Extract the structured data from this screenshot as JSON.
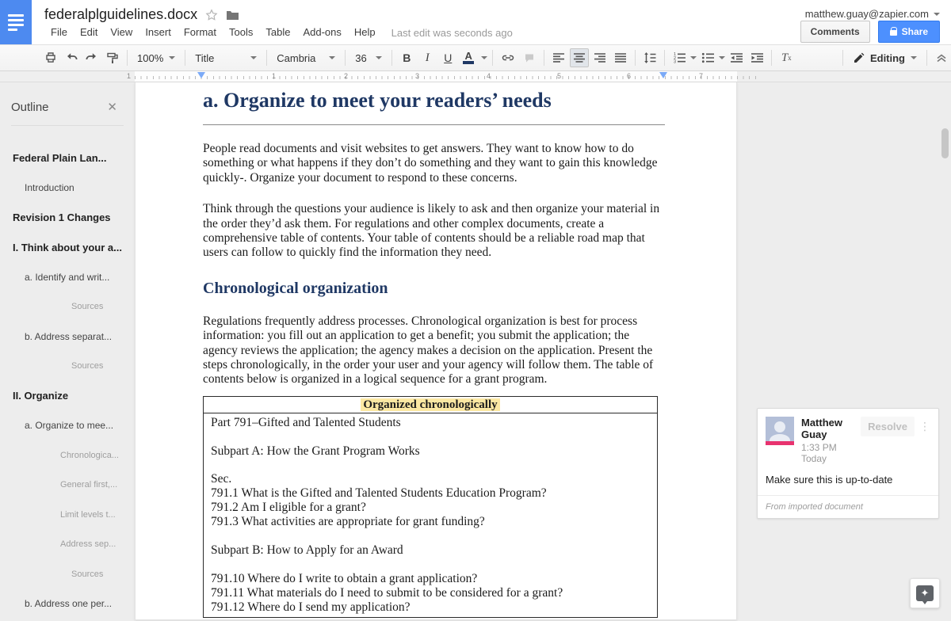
{
  "header": {
    "title": "federalplguidelines.docx",
    "menus": [
      "File",
      "Edit",
      "View",
      "Insert",
      "Format",
      "Tools",
      "Table",
      "Add-ons",
      "Help"
    ],
    "last_edit": "Last edit was seconds ago",
    "account_email": "matthew.guay@zapier.com",
    "comments_button": "Comments",
    "share_button": "Share"
  },
  "toolbar": {
    "zoom_value": "100%",
    "style_value": "Title",
    "font_value": "Cambria",
    "font_size_value": "36",
    "bold_label": "B",
    "italic_label": "I",
    "underline_label": "U",
    "text_color_label": "A",
    "text_color_swatch": "#1f3864",
    "clear_formatting_t": "T",
    "clear_formatting_x": "x",
    "mode_label": "Editing",
    "collapse_glyph": "^"
  },
  "ruler": {
    "numbers": [
      "1",
      "1",
      "2",
      "3",
      "4",
      "5",
      "6",
      "7"
    ]
  },
  "outline": {
    "title": "Outline",
    "close_glyph": "✕",
    "items": [
      {
        "label": "Federal Plain Lan...",
        "class": "lvl1"
      },
      {
        "label": "Introduction",
        "class": "lvl2"
      },
      {
        "label": "Revision 1 Changes",
        "class": "lvl1"
      },
      {
        "label": "I. Think about your a...",
        "class": "lvl1"
      },
      {
        "label": "a. Identify and writ...",
        "class": "lvl2"
      },
      {
        "label": "Sources",
        "class": "lvl4"
      },
      {
        "label": "b. Address separat...",
        "class": "lvl2"
      },
      {
        "label": "Sources",
        "class": "lvl4"
      },
      {
        "label": "II. Organize",
        "class": "lvl1"
      },
      {
        "label": "a. Organize to mee...",
        "class": "lvl2"
      },
      {
        "label": "Chronologica...",
        "class": "lvl3"
      },
      {
        "label": "General first,...",
        "class": "lvl3"
      },
      {
        "label": "Limit levels t...",
        "class": "lvl3"
      },
      {
        "label": "Address sep...",
        "class": "lvl3"
      },
      {
        "label": "Sources",
        "class": "lvl4"
      },
      {
        "label": "b. Address one per...",
        "class": "lvl2"
      }
    ]
  },
  "document": {
    "heading1": "a. Organize to meet your readers’ needs",
    "para1": "People read documents and visit websites to get answers. They want to know how to do something or what happens if they don’t do something and they want to gain this knowledge quickly-. Organize your document to respond to these concerns.",
    "para2": "Think through the questions your audience is likely to ask and then organize your material in the order they’d ask them. For regulations and other complex documents, create a comprehensive table of contents. Your table of contents should be a reliable road map that users can follow to quickly find the information they need.",
    "heading2": "Chronological organization",
    "para3": "Regulations frequently address processes. Chronological organization is best for process information: you fill out an application to get a benefit; you submit the application; the agency reviews the application; the agency makes a decision on the application. Present the steps chronologically, in the order your user and your agency will follow them. The table of contents below is organized in a logical sequence for a grant program.",
    "table": {
      "header": "Organized chronologically",
      "highlight_color": "#fce8a3",
      "lines": [
        "Part 791–Gifted and Talented Students",
        "",
        "Subpart A: How the Grant Program Works",
        "",
        "Sec.",
        "791.1 What is the Gifted and Talented Students Education Program?",
        "791.2 Am I eligible for a grant?",
        "791.3 What activities are appropriate for grant funding?",
        "",
        "Subpart B: How to Apply for an Award",
        "",
        "791.10 Where do I write to obtain a grant application?",
        "791.11 What materials do I need to submit to be considered for a grant?",
        "791.12 Where do I send my application?"
      ]
    }
  },
  "comment": {
    "author": "Matthew Guay",
    "time": "1:33 PM Today",
    "resolve_label": "Resolve",
    "menu_glyph": "⋮",
    "text": "Make sure this is up-to-date",
    "footer": "From imported document",
    "avatar_accent": "#e8336f"
  },
  "explore": {
    "glyph": "✦"
  }
}
